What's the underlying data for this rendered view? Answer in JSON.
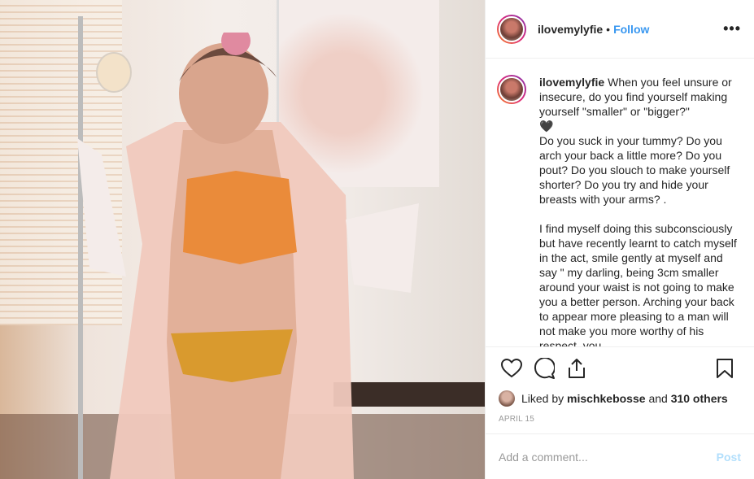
{
  "photo": {
    "alt": "post-photo"
  },
  "header": {
    "username": "ilovemylyfie",
    "dot": "•",
    "follow": "Follow",
    "more": "•••"
  },
  "caption": {
    "username": "ilovemylyfie",
    "text": "When you feel unsure or insecure, do you find yourself making yourself \"smaller\" or \"bigger?\"\n🖤\nDo you suck in your tummy? Do you arch your back a little more? Do you pout? Do you slouch to make yourself shorter? Do you try and hide your breasts with your arms? .\n\nI find myself doing this subconsciously but have recently learnt to catch myself in the act, smile gently at myself and say \" my darling, being 3cm smaller around your waist is not going to make you a better person. Arching your back to appear more pleasing to a man will not make you more worthy of his respect, you"
  },
  "likes": {
    "prefix": "Liked by ",
    "user": "mischkebosse",
    "middle": " and ",
    "count": "310 others"
  },
  "date": "APRIL 15",
  "comment": {
    "placeholder": "Add a comment...",
    "post": "Post"
  },
  "icons": [
    "heart-icon",
    "comment-icon",
    "share-icon",
    "bookmark-icon"
  ]
}
